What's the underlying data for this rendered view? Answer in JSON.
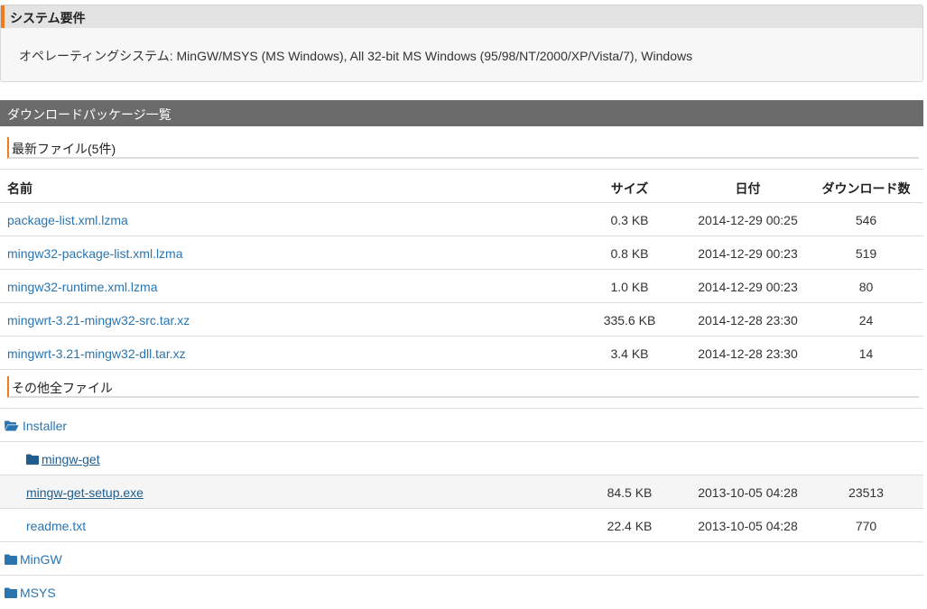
{
  "sysreq": {
    "title": "システム要件",
    "text": "オペレーティングシステム: MinGW/MSYS (MS Windows), All 32-bit MS Windows (95/98/NT/2000/XP/Vista/7), Windows"
  },
  "downloads": {
    "title": "ダウンロードパッケージ一覧",
    "latest_label": "最新ファイル(5件)",
    "columns": {
      "name": "名前",
      "size": "サイズ",
      "date": "日付",
      "count": "ダウンロード数"
    },
    "latest": [
      {
        "name": "package-list.xml.lzma",
        "size": "0.3 KB",
        "date": "2014-12-29 00:25",
        "count": "546"
      },
      {
        "name": "mingw32-package-list.xml.lzma",
        "size": "0.8 KB",
        "date": "2014-12-29 00:23",
        "count": "519"
      },
      {
        "name": "mingw32-runtime.xml.lzma",
        "size": "1.0 KB",
        "date": "2014-12-29 00:23",
        "count": "80"
      },
      {
        "name": "mingwrt-3.21-mingw32-src.tar.xz",
        "size": "335.6 KB",
        "date": "2014-12-28 23:30",
        "count": "24"
      },
      {
        "name": "mingwrt-3.21-mingw32-dll.tar.xz",
        "size": "3.4 KB",
        "date": "2014-12-28 23:30",
        "count": "14"
      }
    ],
    "other_label": "その他全ファイル",
    "tree": {
      "installer": "Installer",
      "mingw_get": "mingw-get",
      "files": [
        {
          "name": "mingw-get-setup.exe",
          "size": "84.5 KB",
          "date": "2013-10-05 04:28",
          "count": "23513"
        },
        {
          "name": "readme.txt",
          "size": "22.4 KB",
          "date": "2013-10-05 04:28",
          "count": "770"
        }
      ],
      "mingw": "MinGW",
      "msys": "MSYS"
    }
  },
  "colors": {
    "accent": "#f07b1e",
    "link": "#2a75b0",
    "header": "#6b6b6b"
  }
}
